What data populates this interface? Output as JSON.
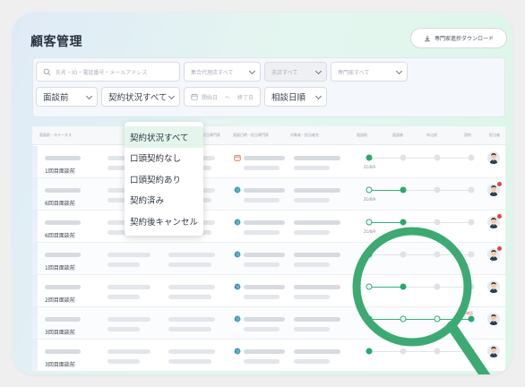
{
  "page": {
    "title": "顧客管理"
  },
  "download_button": {
    "label": "専門家進捗ダウンロード",
    "icon": "download-icon"
  },
  "filters": {
    "search_placeholder": "氏名・ID・電話番号・メールアドレス",
    "agency_placeholder": "集合代理店すべて",
    "branch_placeholder": "支店すべて",
    "expert_placeholder": "専門家すべて",
    "meeting_select": "面談前",
    "contract_select": "契約状況すべて",
    "date_start_placeholder": "開始日",
    "date_sep": "〜",
    "date_end_placeholder": "終了日",
    "sort_select": "相談日順"
  },
  "contract_menu": {
    "options": [
      "契約状況すべて",
      "口頭契約なし",
      "口頭契約あり",
      "契約済み",
      "契約後キャンセル"
    ],
    "selected_index": 0
  },
  "table": {
    "headers": [
      "面談前・ステータス",
      "",
      "",
      "担当代理",
      "担当専門家",
      "面談日時・担当専門家",
      "対象者・担当者名",
      "",
      "面談前",
      "面談後",
      "申込前",
      "契約",
      "担当者"
    ],
    "rows": [
      {
        "label": "1回目面談前",
        "dot_date": "21/6/9",
        "progress": 1,
        "notify": false
      },
      {
        "label": "6回目面談前",
        "dot_date": "21/6/9",
        "progress": 2,
        "notify": true
      },
      {
        "label": "6回目面談前",
        "dot_date": "21/6/9",
        "progress": 2,
        "notify": true
      },
      {
        "label": "1回目面談前",
        "dot_date": "",
        "progress": 0,
        "notify": true
      },
      {
        "label": "2回目面談前",
        "dot_date": "",
        "progress": 2,
        "notify": false
      },
      {
        "label": "3回目面談前",
        "dot_date": "",
        "progress": 4,
        "notify": false,
        "warning": "要確認"
      },
      {
        "label": "3回目面談前",
        "dot_date": "",
        "progress": 1,
        "notify": false
      }
    ]
  },
  "colors": {
    "accent": "#2aa870",
    "magnifier": "#3caa72",
    "badge": "#e3473d"
  }
}
